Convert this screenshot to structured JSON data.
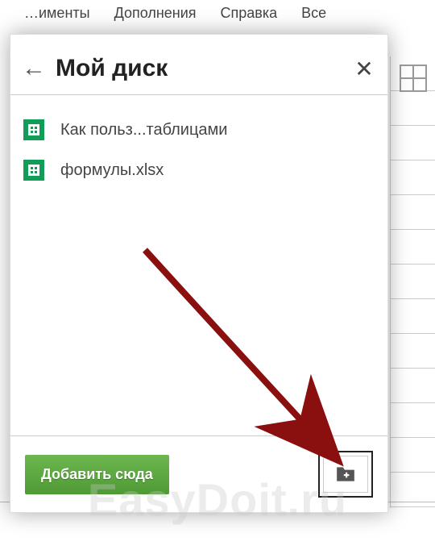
{
  "background": {
    "menu_fragment_1": "…именты",
    "menu_fragment_2": "Дополнения",
    "menu_fragment_3": "Справка",
    "menu_fragment_4": "Все"
  },
  "dialog": {
    "title": "Мой диск",
    "files": [
      {
        "name": "Как польз...таблицами"
      },
      {
        "name": "формулы.xlsx"
      }
    ],
    "footer": {
      "add_label": "Добавить сюда"
    }
  },
  "watermark": "EasyDoit.ru"
}
